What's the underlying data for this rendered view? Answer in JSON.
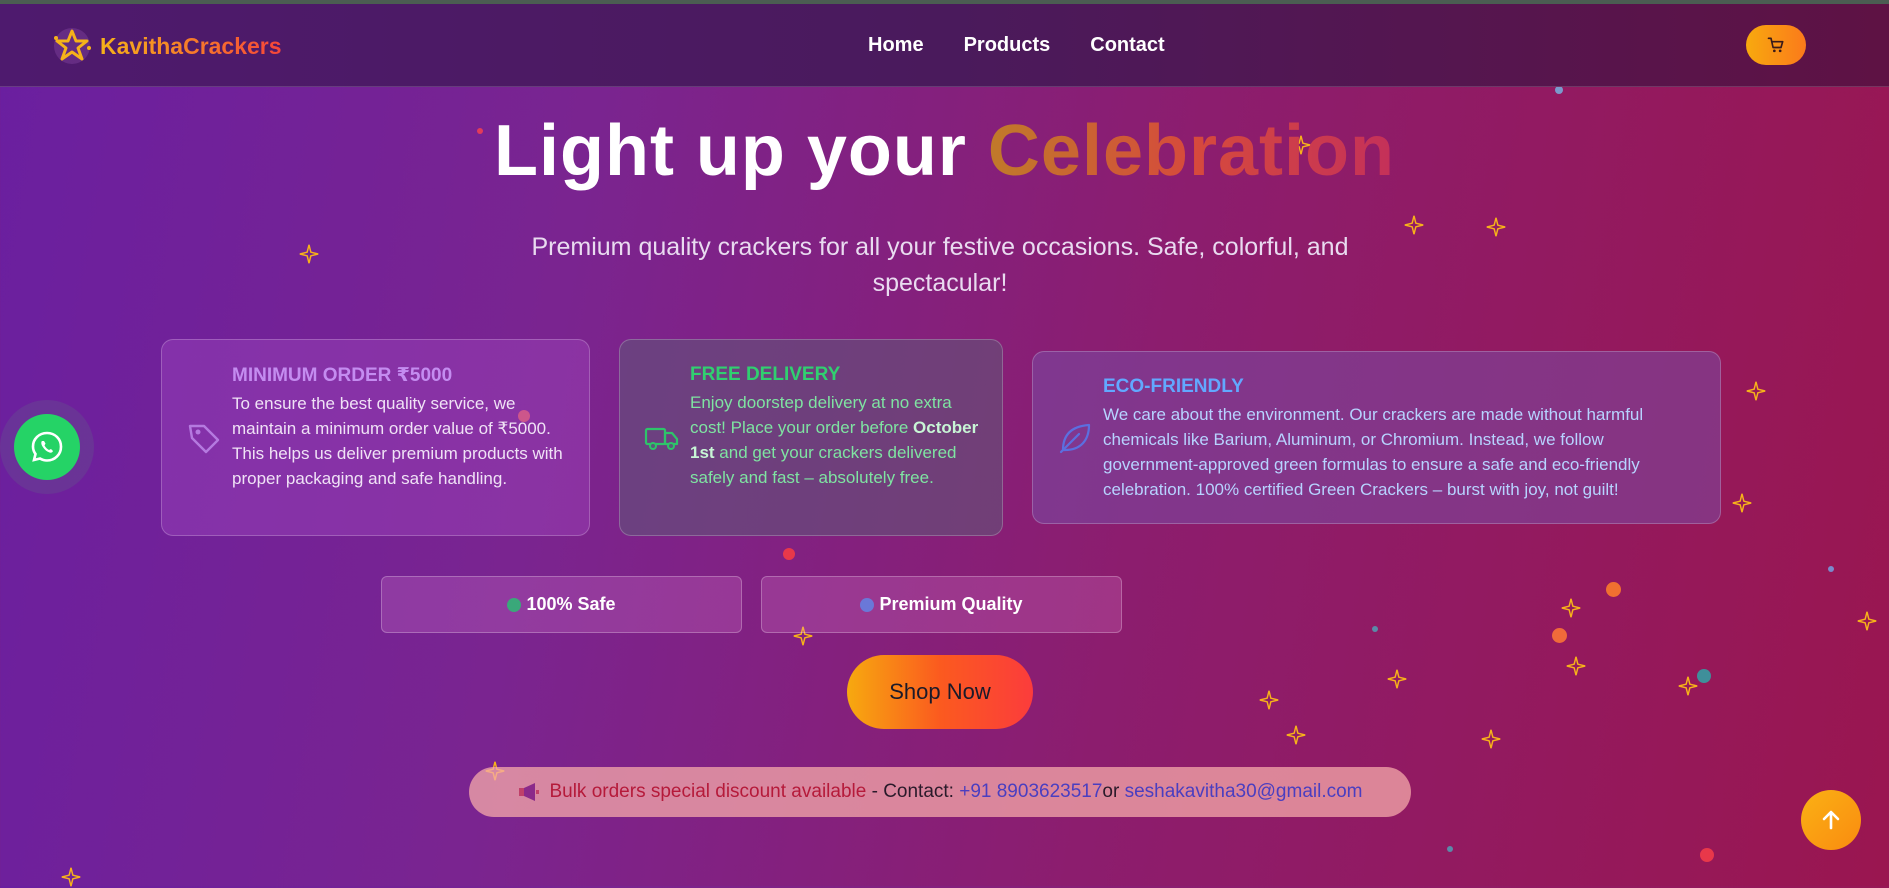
{
  "brand": {
    "name": "KavithaCrackers"
  },
  "nav": {
    "links": [
      {
        "label": "Home"
      },
      {
        "label": "Products"
      },
      {
        "label": "Contact"
      }
    ],
    "cart_icon": "shopping-cart-icon"
  },
  "hero": {
    "title_main": "Light up your ",
    "title_accent": "Celebration",
    "subtitle": "Premium quality crackers for all your festive occasions. Safe, colorful, and spectacular!"
  },
  "cards": [
    {
      "icon": "tag-icon",
      "title": "MINIMUM ORDER ₹5000",
      "text": "To ensure the best quality service, we maintain a minimum order value of ₹5000. This helps us deliver premium products with proper packaging and safe handling."
    },
    {
      "icon": "truck-icon",
      "title": "FREE DELIVERY",
      "text_before": "Enjoy doorstep delivery at no extra cost! Place your order before ",
      "text_bold": "October 1st",
      "text_after": " and get your crackers delivered safely and fast – absolutely free."
    },
    {
      "icon": "leaf-icon",
      "title": "ECO-FRIENDLY",
      "text": "We care about the environment. Our crackers are made without harmful chemicals like Barium, Aluminum, or Chromium. Instead, we follow government-approved green formulas to ensure a safe and eco-friendly celebration. 100% certified Green Crackers – burst with joy, not guilt!"
    }
  ],
  "badges": [
    {
      "label": "100% Safe",
      "dot_color": "#3aa87a"
    },
    {
      "label": "Premium Quality",
      "dot_color": "#6a78d8"
    }
  ],
  "cta": {
    "label": "Shop Now"
  },
  "contact": {
    "icon": "megaphone-icon",
    "highlight": "Bulk orders special discount available",
    "sep": " - Contact: ",
    "phone": "+91 8903623517",
    "or": "or ",
    "email": "seshakavitha30@gmail.com"
  },
  "floating": {
    "whatsapp_icon": "whatsapp-icon",
    "scroll_top_icon": "arrow-up-icon"
  },
  "colors": {
    "accent_orange": "#f8a90e",
    "whatsapp_green": "#25d366",
    "green_text": "#30d070",
    "blue_text": "#62a8ff"
  }
}
